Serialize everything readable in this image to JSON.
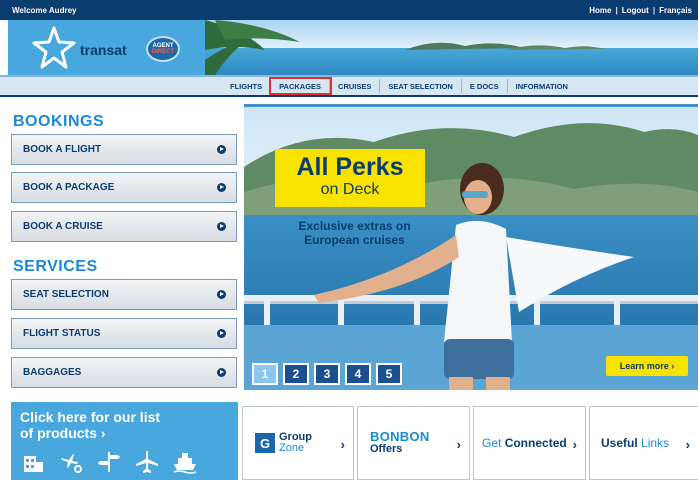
{
  "topbar": {
    "welcome": "Welcome Audrey",
    "links": [
      "Home",
      "Logout",
      "Français"
    ],
    "separator": "|"
  },
  "header": {
    "brand": "transat",
    "agent_badge": [
      "AGENT",
      "DIRECT"
    ]
  },
  "nav": {
    "items": [
      "FLIGHTS",
      "PACKAGES",
      "CRUISES",
      "SEAT SELECTION",
      "E DOCS",
      "INFORMATION"
    ],
    "selected": "PACKAGES"
  },
  "sidebar": {
    "bookings_title": "BOOKINGS",
    "bookings": [
      "BOOK A FLIGHT",
      "BOOK A PACKAGE",
      "BOOK A CRUISE"
    ],
    "services_title": "SERVICES",
    "services": [
      "SEAT SELECTION",
      "FLIGHT STATUS",
      "BAGGAGES"
    ]
  },
  "hero": {
    "title": "All Perks",
    "subtitle": "on Deck",
    "caption_line1": "Exclusive extras on",
    "caption_line2": "European cruises",
    "pages": [
      "1",
      "2",
      "3",
      "4",
      "5"
    ],
    "active_page": "1",
    "cta": "Learn more ›"
  },
  "bottom": {
    "products_line1": "Click here for our list",
    "products_line2": "of products ›",
    "group_zone": {
      "icon": "G",
      "line1": "Group",
      "line2": "Zone",
      "chevron": "›"
    },
    "bonbon": {
      "line1": "BONBON",
      "line2": "Offers",
      "chevron": "›"
    },
    "get_connected": {
      "light": "Get",
      "dark": "Connected",
      "chevron": "›"
    },
    "useful_links": {
      "dark": "Useful",
      "light": "Links",
      "chevron": "›"
    }
  },
  "colors": {
    "navy": "#0b3c6f",
    "sky": "#48a7dc",
    "accent_blue": "#1a8ad4",
    "yellow": "#f7e200",
    "selected_outline": "#d9322f"
  }
}
